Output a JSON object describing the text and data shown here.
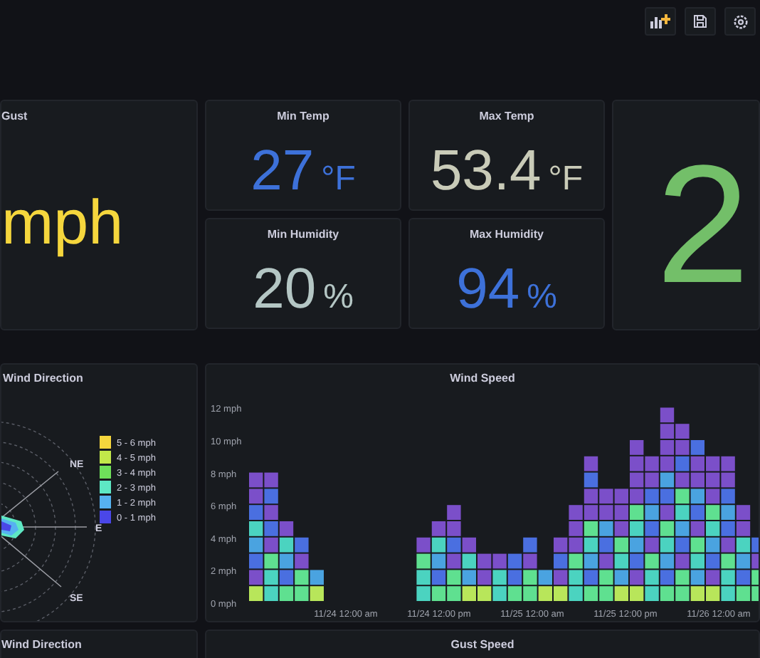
{
  "toolbar": {
    "buttons": [
      {
        "kind": "add-panel"
      },
      {
        "kind": "save"
      },
      {
        "kind": "settings"
      }
    ]
  },
  "gust_panel": {
    "title": "Gust",
    "unit": "mph",
    "color": "#f5d63d"
  },
  "stat_panels": [
    {
      "title": "Min Temp",
      "value": "27",
      "unit": "°F",
      "color": "#3d71d9"
    },
    {
      "title": "Max Temp",
      "value": "53.4",
      "unit": "°F",
      "color": "#c9cbb8"
    },
    {
      "title": "Min Humidity",
      "value": "20",
      "unit": "%",
      "color": "#b4c6c4"
    },
    {
      "title": "Max Humidity",
      "value": "94",
      "unit": "%",
      "color": "#3d71d9"
    }
  ],
  "big_panel": {
    "value": "2",
    "color": "#73bf69"
  },
  "wind_direction_panel": {
    "title": "Wind Direction",
    "compass_labels": [
      "NE",
      "E",
      "SE"
    ],
    "legend": [
      {
        "label": "5 - 6 mph",
        "color": "#f5d63d"
      },
      {
        "label": "4 - 5 mph",
        "color": "#c2e84a"
      },
      {
        "label": "3 - 4 mph",
        "color": "#6fe05a"
      },
      {
        "label": "2 - 3 mph",
        "color": "#5ee8c4"
      },
      {
        "label": "1 - 2 mph",
        "color": "#56b2f0"
      },
      {
        "label": "0 - 1 mph",
        "color": "#4a47e8"
      }
    ]
  },
  "wind_speed_panel": {
    "title": "Wind Speed",
    "y_axis_labels": [
      "12 mph",
      "10 mph",
      "8 mph",
      "6 mph",
      "4 mph",
      "2 mph",
      "0 mph"
    ],
    "x_axis_labels": [
      "11/24 12:00 am",
      "11/24 12:00 pm",
      "11/25 12:00 am",
      "11/25 12:00 pm",
      "11/26 12:00 am"
    ]
  },
  "bottom_panels": [
    {
      "title": "Wind Direction"
    },
    {
      "title": "Gust Speed"
    }
  ]
}
